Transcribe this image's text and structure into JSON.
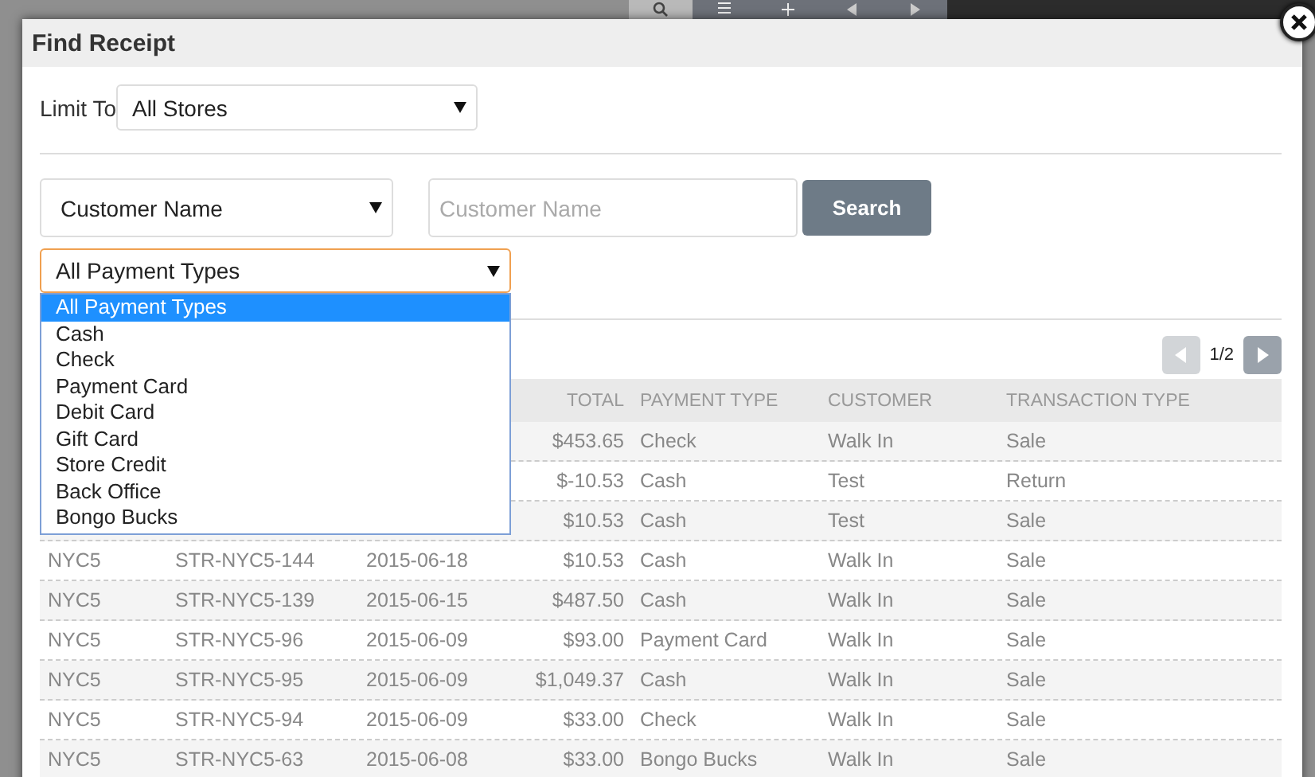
{
  "dialog": {
    "title": "Find Receipt"
  },
  "limit": {
    "label": "Limit To",
    "value": "All Stores"
  },
  "search_by": {
    "value": "Customer Name"
  },
  "search_field": {
    "placeholder": "Customer Name"
  },
  "search_button": "Search",
  "payment_filter": {
    "value": "All Payment Types",
    "expanded": true,
    "options": [
      {
        "label": "All Payment Types",
        "selected": true
      },
      {
        "label": "Cash",
        "selected": false
      },
      {
        "label": "Check",
        "selected": false
      },
      {
        "label": "Payment Card",
        "selected": false
      },
      {
        "label": "Debit Card",
        "selected": false
      },
      {
        "label": "Gift Card",
        "selected": false
      },
      {
        "label": "Store Credit",
        "selected": false
      },
      {
        "label": "Back Office",
        "selected": false
      },
      {
        "label": "Bongo Bucks",
        "selected": false
      }
    ]
  },
  "pagination": {
    "page": "1/2",
    "previous_disabled": true,
    "next_disabled": false
  },
  "table": {
    "columns": [
      null,
      null,
      null,
      "TOTAL",
      "PAYMENT TYPE",
      "CUSTOMER",
      "TRANSACTION TYPE"
    ],
    "rows": [
      [
        null,
        null,
        null,
        "$453.65",
        "Check",
        "Walk In",
        "Sale"
      ],
      [
        null,
        null,
        null,
        "$-10.53",
        "Cash",
        "Test",
        "Return"
      ],
      [
        null,
        null,
        null,
        "$10.53",
        "Cash",
        "Test",
        "Sale"
      ],
      [
        "NYC5",
        "STR-NYC5-144",
        "2015-06-18",
        "$10.53",
        "Cash",
        "Walk In",
        "Sale"
      ],
      [
        "NYC5",
        "STR-NYC5-139",
        "2015-06-15",
        "$487.50",
        "Cash",
        "Walk In",
        "Sale"
      ],
      [
        "NYC5",
        "STR-NYC5-96",
        "2015-06-09",
        "$93.00",
        "Payment Card",
        "Walk In",
        "Sale"
      ],
      [
        "NYC5",
        "STR-NYC5-95",
        "2015-06-09",
        "$1,049.37",
        "Cash",
        "Walk In",
        "Sale"
      ],
      [
        "NYC5",
        "STR-NYC5-94",
        "2015-06-09",
        "$33.00",
        "Check",
        "Walk In",
        "Sale"
      ],
      [
        "NYC5",
        "STR-NYC5-63",
        "2015-06-08",
        "$33.00",
        "Bongo Bucks",
        "Walk In",
        "Sale"
      ]
    ]
  }
}
